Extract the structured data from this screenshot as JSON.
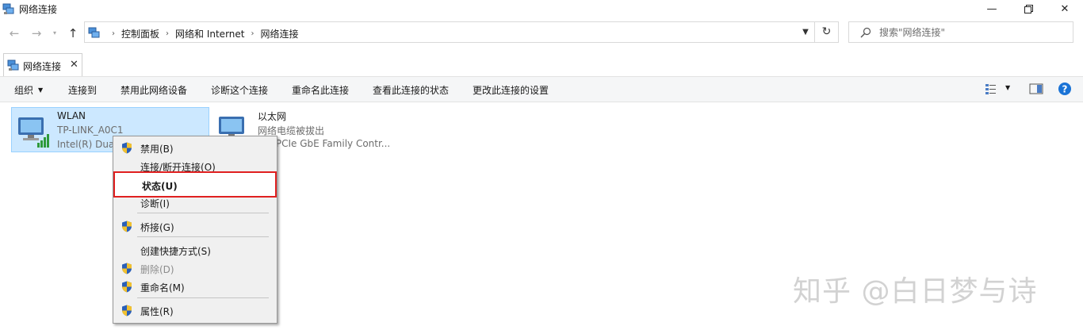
{
  "window": {
    "title": "网络连接",
    "minimize_icon": "minimize-icon",
    "maximize_icon": "restore-icon",
    "close_icon": "close-icon"
  },
  "navigation": {
    "breadcrumb": [
      "控制面板",
      "网络和 Internet",
      "网络连接"
    ],
    "search_placeholder": "搜索\"网络连接\""
  },
  "tab": {
    "label": "网络连接",
    "close": "✕"
  },
  "toolbar": {
    "organize": "组织",
    "connect_to": "连接到",
    "disable_device": "禁用此网络设备",
    "diagnose": "诊断这个连接",
    "rename": "重命名此连接",
    "view_status": "查看此连接的状态",
    "change_settings": "更改此连接的设置"
  },
  "connections": [
    {
      "name": "WLAN",
      "line2": "TP-LINK_A0C1",
      "line3": "Intel(R) Dual"
    },
    {
      "name": "以太网",
      "line2": "网络电缆被拔出",
      "line3": "tek PCIe GbE Family Contr..."
    }
  ],
  "context_menu": {
    "items": [
      {
        "label": "禁用(B)",
        "shield": true,
        "disabled": false
      },
      {
        "label": "连接/断开连接(O)",
        "shield": false,
        "disabled": false
      },
      {
        "label": "状态(U)",
        "shield": false,
        "disabled": false,
        "highlighted": true
      },
      {
        "label": "诊断(I)",
        "shield": false,
        "disabled": false
      },
      {
        "label": "桥接(G)",
        "shield": true,
        "disabled": false
      },
      {
        "label": "创建快捷方式(S)",
        "shield": false,
        "disabled": false
      },
      {
        "label": "删除(D)",
        "shield": true,
        "disabled": true
      },
      {
        "label": "重命名(M)",
        "shield": true,
        "disabled": false
      },
      {
        "label": "属性(R)",
        "shield": true,
        "disabled": false
      }
    ]
  },
  "watermark": "知乎 @白日梦与诗",
  "colors": {
    "selection": "#cce8ff",
    "highlight_border": "#e02020",
    "help_blue": "#1a73d6"
  }
}
